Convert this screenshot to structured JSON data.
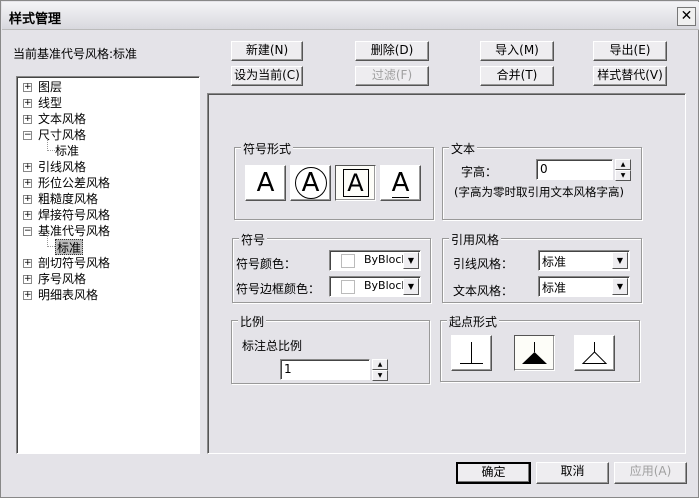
{
  "window": {
    "title": "样式管理",
    "close": "✕"
  },
  "current_label": "当前基准代号风格:标准",
  "buttons": {
    "new": "新建(N)",
    "delete": "删除(D)",
    "import": "导入(M)",
    "export": "导出(E)",
    "set_current": "设为当前(C)",
    "filter": "过滤(F)",
    "merge": "合并(T)",
    "override": "样式替代(V)",
    "ok": "确定",
    "cancel": "取消",
    "apply": "应用(A)"
  },
  "tree": [
    {
      "label": "图层",
      "expanded": false
    },
    {
      "label": "线型",
      "expanded": false
    },
    {
      "label": "文本风格",
      "expanded": false
    },
    {
      "label": "尺寸风格",
      "expanded": true
    },
    {
      "label": "标准",
      "child": true
    },
    {
      "label": "引线风格",
      "expanded": false
    },
    {
      "label": "形位公差风格",
      "expanded": false
    },
    {
      "label": "粗糙度风格",
      "expanded": false
    },
    {
      "label": "焊接符号风格",
      "expanded": false
    },
    {
      "label": "基准代号风格",
      "expanded": true
    },
    {
      "label": "标准",
      "child": true,
      "selected": true
    },
    {
      "label": "剖切符号风格",
      "expanded": false
    },
    {
      "label": "序号风格",
      "expanded": false
    },
    {
      "label": "明细表风格",
      "expanded": false
    }
  ],
  "symbol_form": {
    "title": "符号形式",
    "options": [
      "A",
      "A",
      "A",
      "A"
    ],
    "selected_index": 2
  },
  "text": {
    "title": "文本",
    "height_label": "字高：",
    "height_value": "0",
    "note": "(字高为零时取引用文本风格字高)"
  },
  "symbol": {
    "title": "符号",
    "color_label": "符号颜色：",
    "color_value": "ByBlock",
    "frame_color_label": "符号边框颜色：",
    "frame_color_value": "ByBlock"
  },
  "ref_style": {
    "title": "引用风格",
    "leader_label": "引线风格：",
    "leader_value": "标准",
    "text_label": "文本风格：",
    "text_value": "标准"
  },
  "scale": {
    "title": "比例",
    "label": "标注总比例",
    "value": "1"
  },
  "start_form": {
    "title": "起点形式",
    "selected_index": 1
  }
}
